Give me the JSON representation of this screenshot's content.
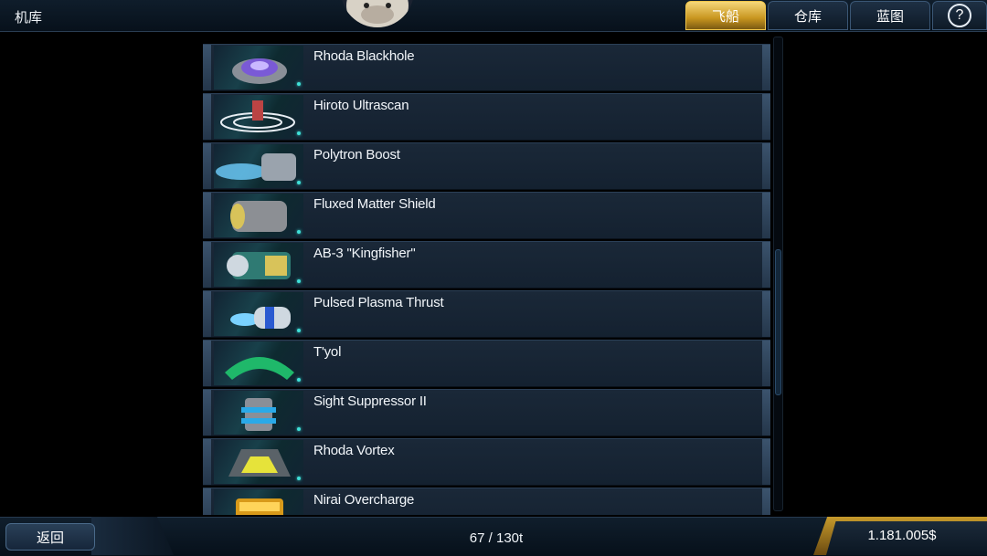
{
  "header": {
    "title": "机库",
    "tabs": [
      {
        "label": "飞船",
        "active": true
      },
      {
        "label": "仓库",
        "active": false
      },
      {
        "label": "蓝图",
        "active": false
      }
    ],
    "help_label": "?"
  },
  "items": [
    {
      "name": "Rhoda Blackhole",
      "icon": "blackhole-module-icon"
    },
    {
      "name": "Hiroto Ultrascan",
      "icon": "scanner-module-icon"
    },
    {
      "name": "Polytron Boost",
      "icon": "booster-module-icon"
    },
    {
      "name": "Fluxed Matter Shield",
      "icon": "shield-module-icon"
    },
    {
      "name": "AB-3 \"Kingfisher\"",
      "icon": "weapon-module-icon"
    },
    {
      "name": "Pulsed Plasma Thrust",
      "icon": "thruster-module-icon"
    },
    {
      "name": "T'yol",
      "icon": "armor-module-icon"
    },
    {
      "name": "Sight Suppressor II",
      "icon": "suppressor-module-icon"
    },
    {
      "name": "Rhoda Vortex",
      "icon": "vortex-module-icon"
    },
    {
      "name": "Nirai Overcharge",
      "icon": "overcharge-module-icon"
    }
  ],
  "footer": {
    "back_label": "返回",
    "capacity": "67 / 130t",
    "money": "1.181.005$"
  },
  "colors": {
    "accent_gold": "#d4a531",
    "status_dot": "#3fe0d8",
    "panel_bg": "#1a2838"
  }
}
